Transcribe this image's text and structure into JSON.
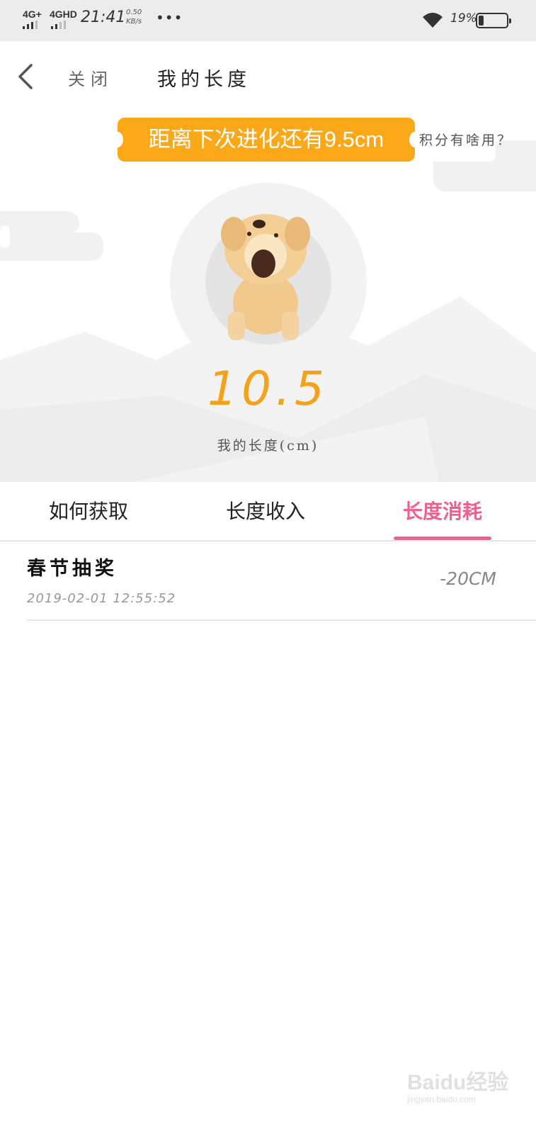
{
  "status_bar": {
    "net1": "4G+",
    "net2": "4GHD",
    "time": "21:41",
    "speed_value": "0.50",
    "speed_unit": "KB/s",
    "dots": "•••",
    "battery_percent": "19%",
    "battery_level": 0.19
  },
  "header": {
    "back_icon": "chevron-left-icon",
    "close_label": "关闭",
    "title": "我的长度"
  },
  "hero": {
    "evolve_text": "距离下次进化还有9.5cm",
    "points_help": "积分有啥用？",
    "length_value": "10.5",
    "length_label": "我的长度(cm)",
    "accent_color": "#f4a21a",
    "banner_color": "#fba818"
  },
  "tabs": [
    {
      "label": "如何获取",
      "active": false
    },
    {
      "label": "长度收入",
      "active": false
    },
    {
      "label": "长度消耗",
      "active": true
    }
  ],
  "active_tab_color": "#ef5f8f",
  "records": [
    {
      "title": "春节抽奖",
      "time": "2019-02-01 12:55:52",
      "amount": "-20CM"
    }
  ],
  "watermark": {
    "logo": "Baidu经验",
    "url": "jingyan.baidu.com"
  }
}
